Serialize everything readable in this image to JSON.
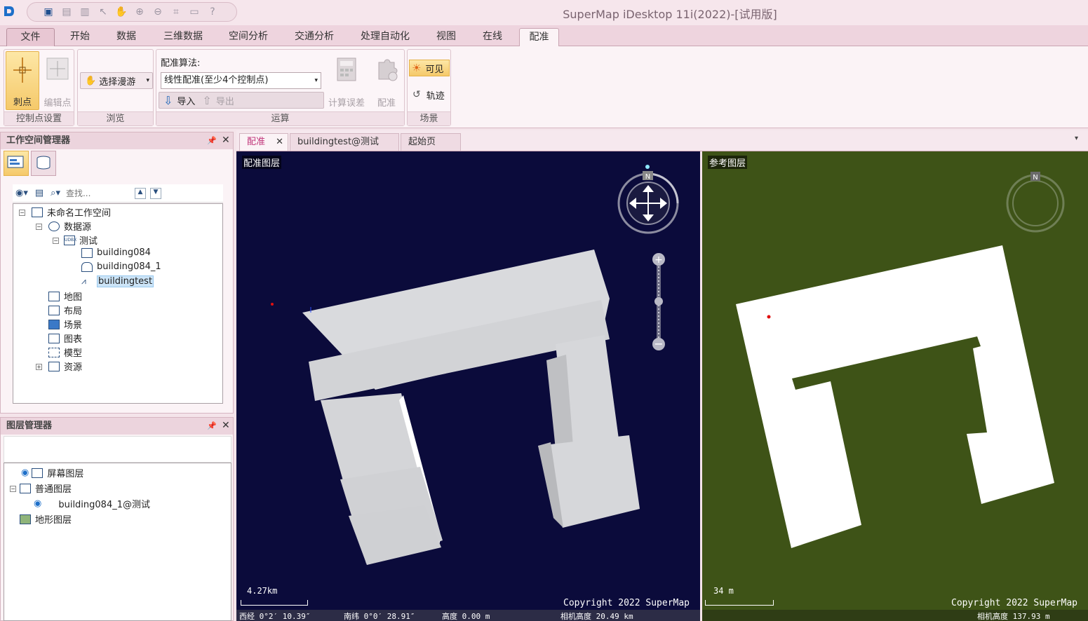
{
  "title": "SuperMap iDesktop 11i(2022)-[试用版]",
  "ribbon_tabs": [
    "文件",
    "开始",
    "数据",
    "三维数据",
    "空间分析",
    "交通分析",
    "处理自动化",
    "视图",
    "在线",
    "配准"
  ],
  "active_tab": "配准",
  "ribbon": {
    "control_points": {
      "label": "控制点设置",
      "prick": "刺点",
      "edit": "编辑点"
    },
    "browse": {
      "label": "浏览",
      "select_pan": "选择漫游"
    },
    "compute": {
      "label": "运算",
      "algorithm_label": "配准算法:",
      "algorithm_value": "线性配准(至少4个控制点)",
      "import": "导入",
      "export": "导出",
      "calc_error": "计算误差",
      "register": "配准"
    },
    "scene": {
      "label": "场景",
      "visible": "可见",
      "track": "轨迹"
    }
  },
  "workspace": {
    "title": "工作空间管理器",
    "search_placeholder": "查找...",
    "tree": {
      "root": "未命名工作空间",
      "datasources": "数据源",
      "ds_name": "测试",
      "ds_badge": "UDBX",
      "datasets": [
        "building084",
        "building084_1",
        "buildingtest"
      ],
      "selected": "buildingtest",
      "maps": "地图",
      "layouts": "布局",
      "scenes": "场景",
      "charts": "图表",
      "models": "模型",
      "resources": "资源"
    }
  },
  "layers": {
    "title": "图层管理器",
    "screen": "屏幕图层",
    "normal": "普通图层",
    "normal_child": "building084_1@测试",
    "terrain": "地形图层"
  },
  "doc_tabs": [
    "配准",
    "buildingtest@测试",
    "起始页"
  ],
  "left_view": {
    "label": "配准图层",
    "scale": "4.27km",
    "copyright": "Copyright 2022 SuperMap",
    "status": {
      "lon": "西经 0°2′ 10.39″",
      "lat": "南纬 0°0′ 28.91″",
      "height": "高度 0.00 m",
      "cam": "相机高度 20.49 km"
    },
    "compass": "N",
    "bg_color": "#0b0b3b"
  },
  "right_view": {
    "label": "参考图层",
    "scale": "34 m",
    "copyright": "Copyright 2022 SuperMap",
    "cam": "相机高度 137.93 m",
    "compass": "N",
    "bg_color": "#3e5317"
  }
}
